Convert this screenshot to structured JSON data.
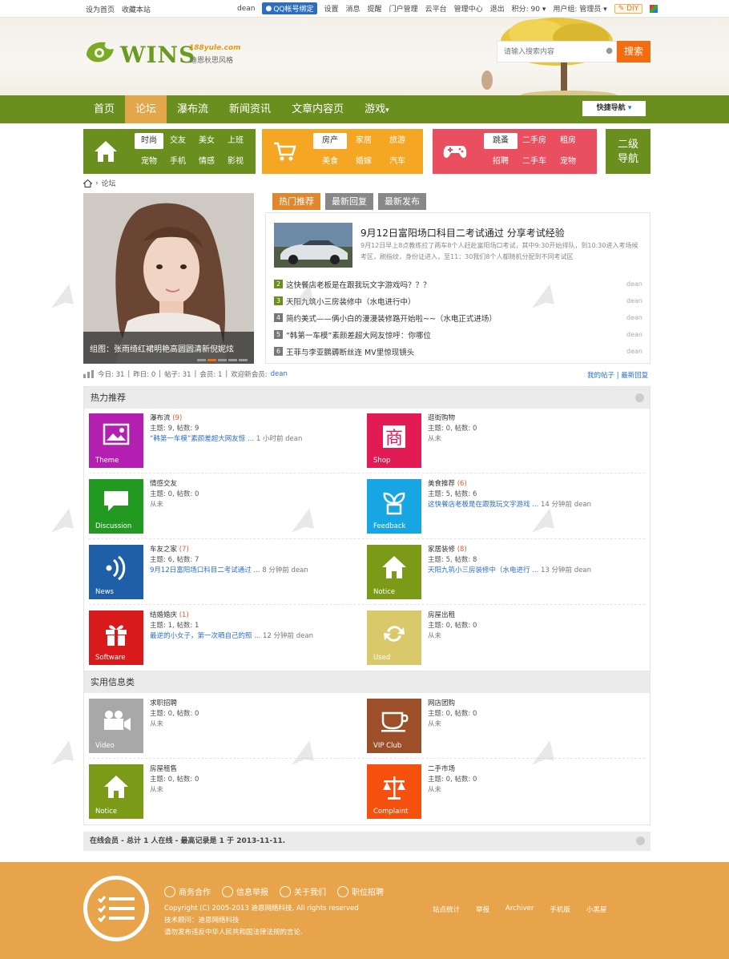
{
  "topbar": {
    "set_home": "设为首页",
    "bookmark": "收藏本站",
    "username": "dean",
    "qq_bind": "QQ帐号绑定",
    "links": [
      "设置",
      "消息",
      "提醒",
      "门户管理",
      "云平台",
      "管理中心",
      "退出"
    ],
    "points": "积分: 90",
    "usergroup": "用户组: 管理员",
    "diy": "DIY"
  },
  "header": {
    "logo_text": "WINS",
    "logo_site": "188yule.com",
    "logo_sub": "迪恩秋思风格",
    "search_placeholder": "请输入搜索内容",
    "search_button": "搜索"
  },
  "nav": {
    "items": [
      "首页",
      "论坛",
      "瀑布流",
      "新闻资讯",
      "文章内容页",
      "游戏"
    ],
    "active_index": 1,
    "quick_nav": "快捷导航"
  },
  "subnav": [
    {
      "color": "#6b8f1f",
      "icon": "home-icon",
      "links": [
        "时尚",
        "交友",
        "美女",
        "上班",
        "宠物",
        "手机",
        "情感",
        "影视"
      ],
      "selected": 0
    },
    {
      "color": "#f5a623",
      "icon": "cart-icon",
      "links": [
        "房产",
        "家居",
        "旅游",
        "美食",
        "婚嫁",
        "汽车"
      ],
      "selected": 0
    },
    {
      "color": "#e94f5e",
      "icon": "gamepad-icon",
      "links": [
        "跳蚤",
        "二手房",
        "租房",
        "招聘",
        "二手车",
        "宠物"
      ],
      "selected": 0
    }
  ],
  "subnav_secondary": "二级\n导航",
  "breadcrumb": {
    "current": "论坛"
  },
  "slide": {
    "caption": "组图：张雨绮红裙明艳高圆圆清新倪妮炫",
    "count": 5,
    "active": 2
  },
  "tabs": {
    "items": [
      "热门推荐",
      "最新回复",
      "最新发布"
    ],
    "active": 0
  },
  "featured": {
    "title": "9月12日富阳场口科目二考试通过 分享考试经验",
    "desc": "9月12日早上8点教练拉了两车8个人赶赴富阳场口考试，其中9:30开始排队，到10:30进入考场候考区，刷指纹，身份证进入，至11：30我们8个人都随机分配到不同考试区"
  },
  "hot_list": [
    {
      "num": "2",
      "title": "这快餐店老板是在跟我玩文字游戏吗？？？",
      "author": "dean"
    },
    {
      "num": "3",
      "title": "天阳九筑小三房装修中（水电进行中）",
      "author": "dean"
    },
    {
      "num": "4",
      "title": "简约美式——俩小白的漫漫装修路开始啦~~（水电正式进场）",
      "author": "dean"
    },
    {
      "num": "5",
      "title": "“韩第一车模”素颜差超大网友惊呼：你哪位",
      "author": "dean"
    },
    {
      "num": "6",
      "title": "王菲与李亚鹏薅断丝连 MV里惊现镜头",
      "author": "dean"
    }
  ],
  "stats": {
    "today": "今日: 31",
    "yesterday": "昨日: 0",
    "posts": "帖子: 31",
    "members": "会员: 1",
    "welcome": "欢迎新会员:",
    "new_member": "dean",
    "my_posts": "我的帖子",
    "latest_replies": "最新回复"
  },
  "sections": [
    {
      "title": "热力推荐",
      "forums": [
        {
          "name": "瀑布流",
          "today": "(9)",
          "counts": "主题: 9, 帖数: 9",
          "last": "“韩第一车模”素颜差超大网友惊 ...",
          "time": "1 小时前 dean",
          "color": "#b31fb1",
          "label": "Theme",
          "icon": "image-icon"
        },
        {
          "name": "逛街购物",
          "today": "",
          "counts": "主题: 0, 帖数: 0",
          "last": "",
          "time": "从未",
          "color": "#e31b55",
          "label": "Shop",
          "icon": "shop-icon"
        },
        {
          "name": "情感交友",
          "today": "",
          "counts": "主题: 0, 帖数: 0",
          "last": "",
          "time": "从未",
          "color": "#229a22",
          "label": "Discussion",
          "icon": "chat-icon"
        },
        {
          "name": "美食推荐",
          "today": "(6)",
          "counts": "主题: 5, 帖数: 6",
          "last": "这快餐店老板是在跟我玩文字游戏 ...",
          "time": "14 分钟前 dean",
          "color": "#17a6e3",
          "label": "Feedback",
          "icon": "plant-icon"
        },
        {
          "name": "车友之家",
          "today": "(7)",
          "counts": "主题: 6, 帖数: 7",
          "last": "9月12日富阳场口科目二考试通过 ...",
          "time": "8 分钟前 dean",
          "color": "#1f5fa8",
          "label": "News",
          "icon": "rss-icon"
        },
        {
          "name": "家居装修",
          "today": "(8)",
          "counts": "主题: 5, 帖数: 8",
          "last": "天阳九筑小三房装修中（水电进行 ...",
          "time": "13 分钟前 dean",
          "color": "#7b9a17",
          "label": "Notice",
          "icon": "home-icon"
        },
        {
          "name": "结婚婚庆",
          "today": "(1)",
          "counts": "主题: 1, 帖数: 1",
          "last": "最逆的小女子，第一次晒自己的照 ...",
          "time": "12 分钟前 dean",
          "color": "#d91a1a",
          "label": "Software",
          "icon": "gift-icon"
        },
        {
          "name": "房屋出租",
          "today": "",
          "counts": "主题: 0, 帖数: 0",
          "last": "",
          "time": "从未",
          "color": "#d9c96a",
          "label": "Used",
          "icon": "recycle-icon"
        }
      ]
    },
    {
      "title": "实用信息类",
      "forums": [
        {
          "name": "求职招聘",
          "today": "",
          "counts": "主题: 0, 帖数: 0",
          "last": "",
          "time": "从未",
          "color": "#a8a8a8",
          "label": "Video",
          "icon": "video-icon"
        },
        {
          "name": "网店团购",
          "today": "",
          "counts": "主题: 0, 帖数: 0",
          "last": "",
          "time": "从未",
          "color": "#9c4f28",
          "label": "VIP Club",
          "icon": "cup-icon"
        },
        {
          "name": "房屋租售",
          "today": "",
          "counts": "主题: 0, 帖数: 0",
          "last": "",
          "time": "从未",
          "color": "#7b9a17",
          "label": "Notice",
          "icon": "home-icon"
        },
        {
          "name": "二手市场",
          "today": "",
          "counts": "主题: 0, 帖数: 0",
          "last": "",
          "time": "从未",
          "color": "#f5500e",
          "label": "Complaint",
          "icon": "scale-icon"
        }
      ]
    }
  ],
  "online": "在线会员 - 总计 1 人在线 - 最高记录是 1 于 2013-11-11.",
  "footer": {
    "links": [
      "商务合作",
      "信息举报",
      "关于我们",
      "职位招聘"
    ],
    "copyright": "Copyright (C) 2005-2013 迪恩网络科技, All rights reserved",
    "tech": "技术顾问：迪恩网络科技",
    "notice": "请勿发布违反中华人民共和国法律法规的言论.",
    "right_links": [
      "站点统计",
      "举报",
      "Archiver",
      "手机版",
      "小黑屋"
    ]
  }
}
